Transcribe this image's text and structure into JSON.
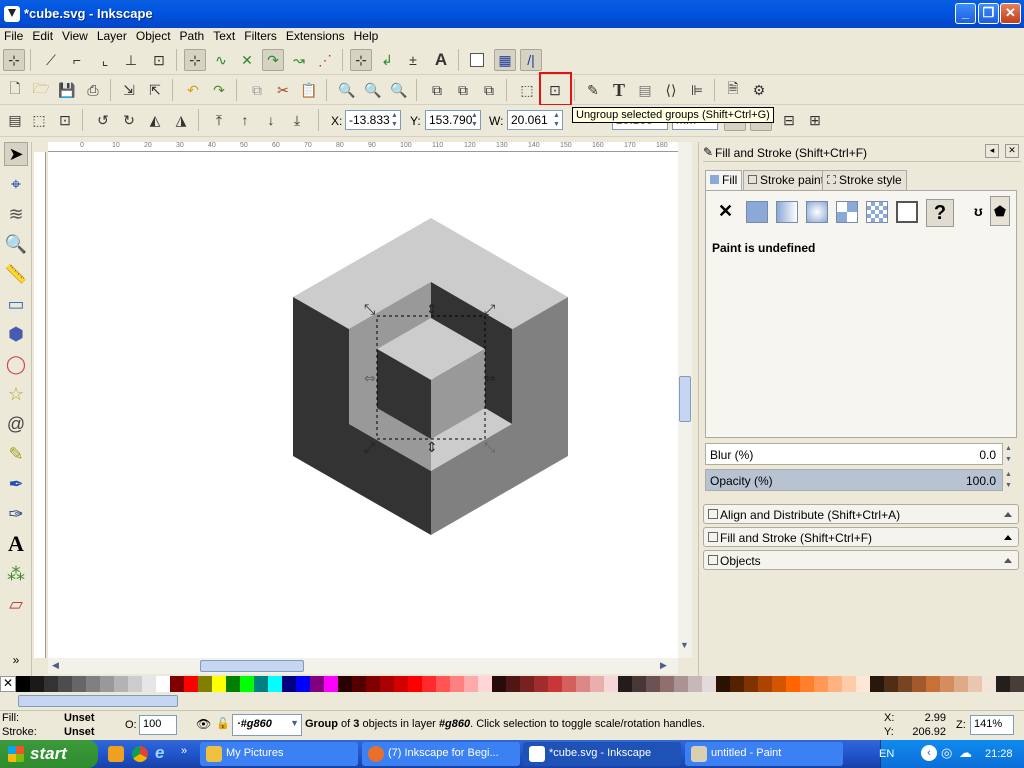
{
  "window": {
    "title": "*cube.svg - Inkscape"
  },
  "menu": [
    "File",
    "Edit",
    "View",
    "Layer",
    "Object",
    "Path",
    "Text",
    "Filters",
    "Extensions",
    "Help"
  ],
  "tooltip": "Ungroup selected groups (Shift+Ctrl+G)",
  "toolbar_select": {
    "x_label": "X:",
    "x_value": "-13.833",
    "y_label": "Y:",
    "y_value": "153.790",
    "w_label": "W:",
    "w_value": "20.061",
    "h_value": "20.100",
    "unit": "mm"
  },
  "rulers": {
    "top_ticks": [
      "0",
      "10",
      "20",
      "30",
      "40",
      "50",
      "60",
      "70",
      "80",
      "90",
      "100",
      "110",
      "120",
      "130",
      "140",
      "150",
      "160",
      "170",
      "180",
      "190",
      "200"
    ]
  },
  "dock": {
    "header": "Fill and Stroke (Shift+Ctrl+F)",
    "tabs": [
      "Fill",
      "Stroke paint",
      "Stroke style"
    ],
    "paint_message": "Paint is undefined",
    "blur_label": "Blur (%)",
    "blur_value": "0.0",
    "opacity_label": "Opacity (%)",
    "opacity_value": "100.0",
    "opacity_fraction": 1.0,
    "panels": [
      "Align and Distribute (Shift+Ctrl+A)",
      "Fill and Stroke (Shift+Ctrl+F)",
      "Objects"
    ]
  },
  "palette_colors": [
    "#000000",
    "#1a1a1a",
    "#333333",
    "#4d4d4d",
    "#666666",
    "#808080",
    "#999999",
    "#b3b3b3",
    "#cccccc",
    "#e6e6e6",
    "#ffffff",
    "#800000",
    "#ff0000",
    "#808000",
    "#ffff00",
    "#008000",
    "#00ff00",
    "#008080",
    "#00ffff",
    "#000080",
    "#0000ff",
    "#800080",
    "#ff00ff",
    "#2b0000",
    "#550000",
    "#800000",
    "#aa0000",
    "#d40000",
    "#ff0000",
    "#ff2a2a",
    "#ff5555",
    "#ff8080",
    "#ffaaaa",
    "#ffd5d5",
    "#280b0b",
    "#501616",
    "#782121",
    "#a02c2c",
    "#c83737",
    "#d35f5f",
    "#de8787",
    "#e9afaf",
    "#f4d7d7",
    "#241c1c",
    "#483737",
    "#6c5353",
    "#916f6f",
    "#ac9393",
    "#c8b7b7",
    "#e3dbdb",
    "#2b1100",
    "#552200",
    "#803300",
    "#aa4400",
    "#d45500",
    "#ff6600",
    "#ff7f2a",
    "#ff9955",
    "#ffb380",
    "#ffccaa",
    "#ffe6d5",
    "#28170b",
    "#502d16",
    "#784421",
    "#a05a2c",
    "#c87137",
    "#d38d5f",
    "#deaa87",
    "#e9c6af",
    "#f4e3d7",
    "#241f1c",
    "#483e37"
  ],
  "status": {
    "fill_label": "Fill:",
    "fill_value": "Unset",
    "stroke_label": "Stroke:",
    "stroke_value": "Unset",
    "opacity_label": "O:",
    "opacity_value": "100",
    "layer_value": "#g860",
    "message_bold": "Group",
    "message_rest1": " of ",
    "message_bold2": "3",
    "message_rest2": " objects in layer ",
    "message_layer": "#g860",
    "message_rest3": ". Click selection to toggle scale/rotation handles.",
    "x_label": "X:",
    "x_value": "2.99",
    "y_label": "Y:",
    "y_value": "206.92",
    "zoom_label": "Z:",
    "zoom_value": "141%"
  },
  "taskbar": {
    "start_label": "start",
    "tasks": [
      "My Pictures",
      "(7) Inkscape for Begi...",
      "*cube.svg - Inkscape",
      "untitled - Paint"
    ],
    "lang": "EN",
    "time": "21:28"
  },
  "icons": {
    "tools": [
      "selector-arrow-icon",
      "node-tool-icon",
      "tweak-tool-icon",
      "zoom-tool-icon",
      "measure-tool-icon",
      "rectangle-tool-icon",
      "3d-box-tool-icon",
      "ellipse-tool-icon",
      "star-tool-icon",
      "spiral-tool-icon",
      "pencil-tool-icon",
      "pen-tool-icon",
      "calligraphy-tool-icon",
      "text-tool-icon",
      "spray-tool-icon",
      "eraser-tool-icon"
    ]
  }
}
